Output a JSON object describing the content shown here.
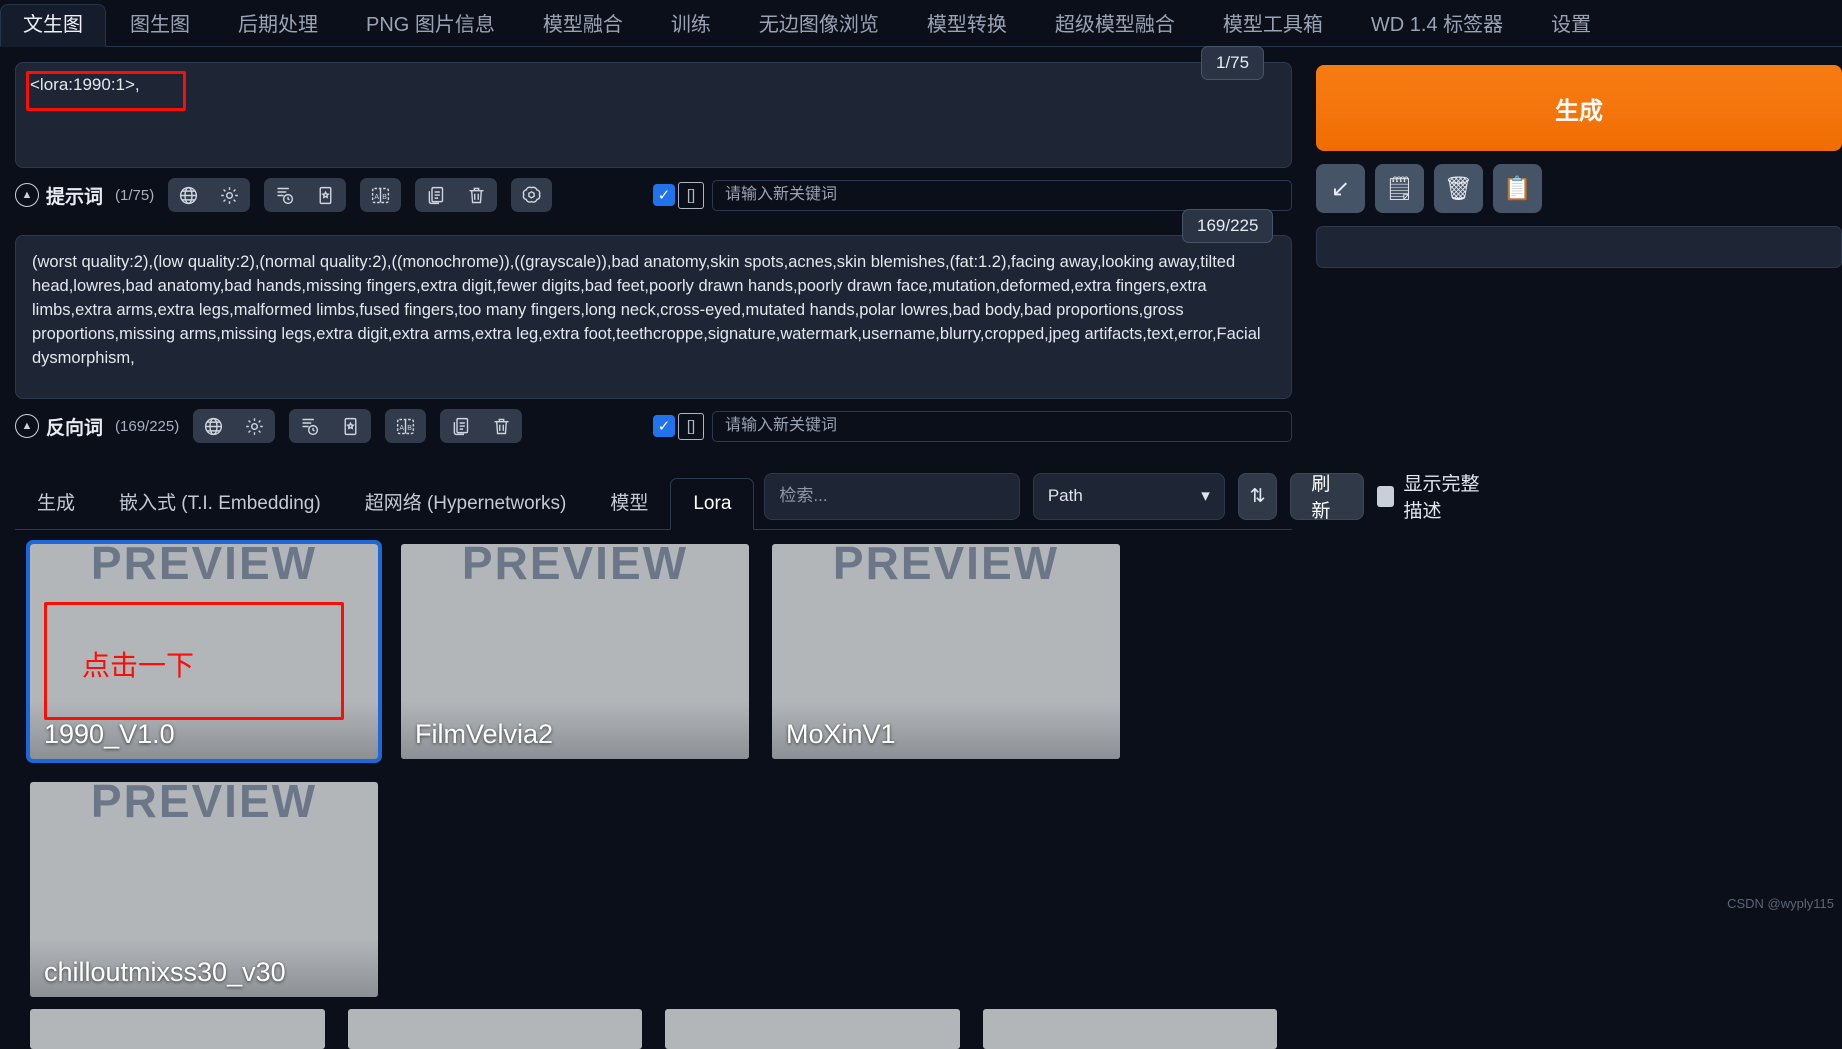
{
  "tabs": [
    {
      "label": "文生图",
      "active": true
    },
    {
      "label": "图生图",
      "active": false
    },
    {
      "label": "后期处理",
      "active": false
    },
    {
      "label": "PNG 图片信息",
      "active": false
    },
    {
      "label": "模型融合",
      "active": false
    },
    {
      "label": "训练",
      "active": false
    },
    {
      "label": "无边图像浏览",
      "active": false
    },
    {
      "label": "模型转换",
      "active": false
    },
    {
      "label": "超级模型融合",
      "active": false
    },
    {
      "label": "模型工具箱",
      "active": false
    },
    {
      "label": "WD 1.4 标签器",
      "active": false
    },
    {
      "label": "设置",
      "active": false
    }
  ],
  "prompt": {
    "value": "<lora:1990:1>,",
    "counter": "1/75",
    "section_label": "提示词",
    "section_count": "(1/75)",
    "keyword_placeholder": "请输入新关键词",
    "keyword_value": ""
  },
  "negative_prompt": {
    "value": "(worst quality:2),(low quality:2),(normal quality:2),((monochrome)),((grayscale)),bad anatomy,skin spots,acnes,skin blemishes,(fat:1.2),facing away,looking away,tilted head,lowres,bad anatomy,bad hands,missing fingers,extra digit,fewer digits,bad feet,poorly drawn hands,poorly drawn face,mutation,deformed,extra fingers,extra limbs,extra arms,extra legs,malformed limbs,fused fingers,too many fingers,long neck,cross-eyed,mutated hands,polar lowres,bad body,bad proportions,gross proportions,missing arms,missing legs,extra digit,extra arms,extra leg,extra foot,teethcroppe,signature,watermark,username,blurry,cropped,jpeg artifacts,text,error,Facial dysmorphism,",
    "counter": "169/225",
    "section_label": "反向词",
    "section_count": "(169/225)",
    "keyword_placeholder": "请输入新关键词",
    "keyword_value": ""
  },
  "prompt_toolbar_icons": [
    "globe-icon",
    "gear-icon",
    "style-list-icon",
    "style-card-icon",
    "translate-ab-icon",
    "copy-icon",
    "trash-icon",
    "openai-icon"
  ],
  "right_panel": {
    "generate_label": "生成",
    "icons": [
      {
        "name": "read-generation-params-icon",
        "glyph": "↙"
      },
      {
        "name": "clear-prompt-icon",
        "glyph": "🗒"
      },
      {
        "name": "delete-icon",
        "glyph": "🗑"
      },
      {
        "name": "paste-styles-icon",
        "glyph": "📋"
      }
    ]
  },
  "extra_networks": {
    "tabs": [
      {
        "label": "生成",
        "active": false
      },
      {
        "label": "嵌入式 (T.I. Embedding)",
        "active": false
      },
      {
        "label": "超网络 (Hypernetworks)",
        "active": false
      },
      {
        "label": "模型",
        "active": false
      },
      {
        "label": "Lora",
        "active": true
      }
    ],
    "search_placeholder": "检索...",
    "search_value": "",
    "sort_select_value": "Path",
    "sort_toggle_icon": "sort-updown-icon",
    "refresh_label": "刷新",
    "show_desc_label": "显示完整描述"
  },
  "lora_cards": [
    {
      "name": "1990_V1.0",
      "preview_text": "PREVIEW",
      "selected": true,
      "annotation": "点击一下"
    },
    {
      "name": "FilmVelvia2",
      "preview_text": "PREVIEW",
      "selected": false
    },
    {
      "name": "MoXinV1",
      "preview_text": "PREVIEW",
      "selected": false
    },
    {
      "name": "chilloutmixss30_v30",
      "preview_text": "PREVIEW",
      "selected": false
    }
  ],
  "watermark": "CSDN @wyply115"
}
